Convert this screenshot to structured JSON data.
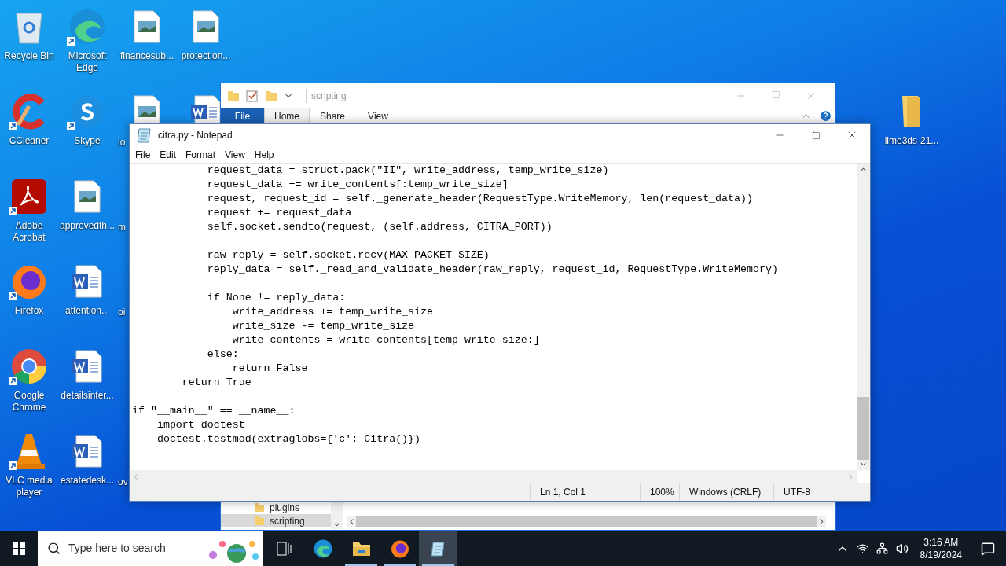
{
  "desktop": {
    "icons": [
      {
        "label": "Recycle Bin",
        "kind": "recycle",
        "shortcut": false
      },
      {
        "label": "Microsoft Edge",
        "kind": "edge",
        "shortcut": true
      },
      {
        "label": "financesub...",
        "kind": "image",
        "shortcut": false
      },
      {
        "label": "protection...",
        "kind": "image",
        "shortcut": false
      },
      {
        "label": "CCleaner",
        "kind": "ccleaner",
        "shortcut": true
      },
      {
        "label": "Skype",
        "kind": "skype",
        "shortcut": true
      },
      {
        "label": "lo",
        "kind": "image"
      },
      {
        "kind": "word",
        "shortcut": false
      },
      {
        "label": "Adobe Acrobat",
        "kind": "acrobat",
        "shortcut": true
      },
      {
        "label": "approvedth...",
        "kind": "image",
        "shortcut": false
      },
      {
        "label": "m",
        "kind": "none"
      },
      {
        "label": "Firefox",
        "kind": "firefox",
        "shortcut": true
      },
      {
        "label": "attention...",
        "kind": "word",
        "shortcut": false
      },
      {
        "label": "oi",
        "kind": "none"
      },
      {
        "label": "Google Chrome",
        "kind": "chrome",
        "shortcut": true
      },
      {
        "label": "detailsinter...",
        "kind": "word",
        "shortcut": false
      },
      {
        "label": "VLC media player",
        "kind": "vlc",
        "shortcut": true
      },
      {
        "label": "estatedesk...",
        "kind": "word",
        "shortcut": false
      },
      {
        "label": "ov",
        "kind": "none"
      },
      {
        "label": "lime3ds-21...",
        "kind": "folder",
        "shortcut": false
      }
    ]
  },
  "explorer": {
    "title": "scripting",
    "file_tab": "File",
    "tabs": [
      {
        "label": "Home",
        "selected": true
      },
      {
        "label": "Share",
        "selected": false
      },
      {
        "label": "View",
        "selected": false
      }
    ],
    "nav_items": [
      {
        "label": "plugins",
        "selected": false
      },
      {
        "label": "scripting",
        "selected": true
      }
    ]
  },
  "notepad": {
    "title": "citra.py - Notepad",
    "menu": [
      "File",
      "Edit",
      "Format",
      "View",
      "Help"
    ],
    "text": "            request_data = struct.pack(\"II\", write_address, temp_write_size)\n            request_data += write_contents[:temp_write_size]\n            request, request_id = self._generate_header(RequestType.WriteMemory, len(request_data))\n            request += request_data\n            self.socket.sendto(request, (self.address, CITRA_PORT))\n\n            raw_reply = self.socket.recv(MAX_PACKET_SIZE)\n            reply_data = self._read_and_validate_header(raw_reply, request_id, RequestType.WriteMemory)\n\n            if None != reply_data:\n                write_address += temp_write_size\n                write_size -= temp_write_size\n                write_contents = write_contents[temp_write_size:]\n            else:\n                return False\n        return True\n\nif \"__main__\" == __name__:\n    import doctest\n    doctest.testmod(extraglobs={'c': Citra()})",
    "status": [
      "Ln 1, Col 1",
      "100%",
      "Windows (CRLF)",
      "UTF-8"
    ]
  },
  "taskbar": {
    "search_placeholder": "Type here to search",
    "apps": [
      {
        "kind": "taskview",
        "running": false,
        "active": false
      },
      {
        "kind": "edge",
        "running": false,
        "active": false
      },
      {
        "kind": "explorer",
        "running": true,
        "active": false
      },
      {
        "kind": "firefox",
        "running": true,
        "active": false
      },
      {
        "kind": "notepad",
        "running": true,
        "active": true
      }
    ],
    "time": "3:16 AM",
    "date": "8/19/2024"
  }
}
